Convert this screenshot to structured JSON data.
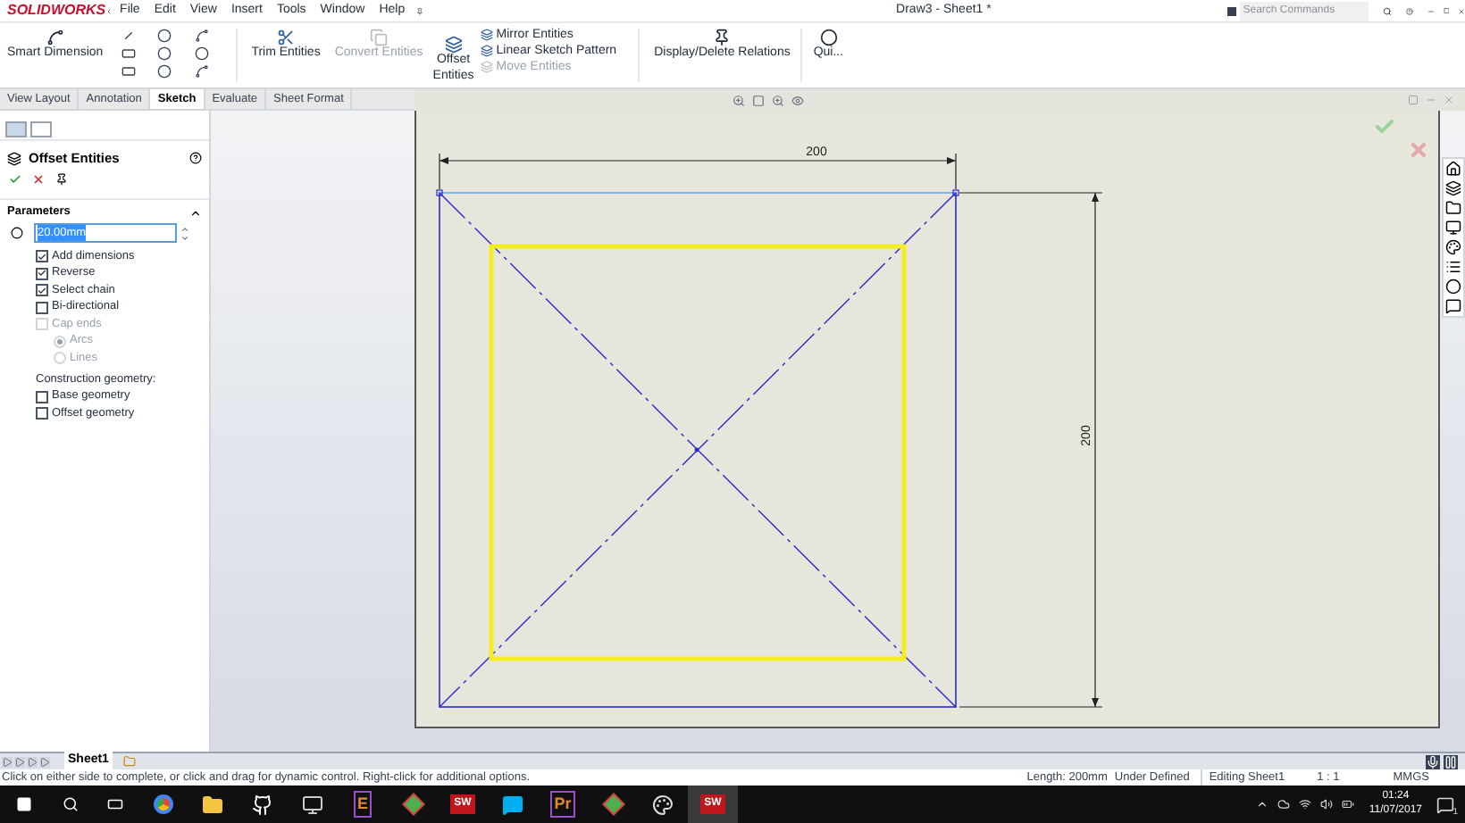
{
  "app": {
    "logo": "SOLIDWORKS",
    "menu": [
      "File",
      "Edit",
      "View",
      "Insert",
      "Tools",
      "Window",
      "Help"
    ],
    "title": "Draw3 - Sheet1 *",
    "search": {
      "placeholder": "Search Commands"
    }
  },
  "ribbon": {
    "large_tools": [
      {
        "label": "Smart Dimension",
        "disabled": false
      },
      {
        "label": "Trim Entities",
        "disabled": false
      },
      {
        "label": "Convert Entities",
        "disabled": true
      },
      {
        "label": "Offset Entities",
        "disabled": false
      }
    ],
    "small_tools": [
      {
        "label": "Mirror Entities",
        "disabled": false
      },
      {
        "label": "Linear Sketch Pattern",
        "disabled": false
      },
      {
        "label": "Move Entities",
        "disabled": true
      }
    ],
    "end_tools": [
      {
        "label": "Display/Delete Relations",
        "disabled": false
      },
      {
        "label": "Qui...",
        "disabled": false
      }
    ]
  },
  "tabs": [
    {
      "label": "View Layout",
      "selected": false
    },
    {
      "label": "Annotation",
      "selected": false
    },
    {
      "label": "Sketch",
      "selected": true
    },
    {
      "label": "Evaluate",
      "selected": false
    },
    {
      "label": "Sheet Format",
      "selected": false
    }
  ],
  "property_manager": {
    "title": "Offset Entities",
    "section": "Parameters",
    "distance": "20.00mm",
    "options": [
      {
        "kind": "checkbox",
        "label": "Add dimensions",
        "checked": true,
        "disabled": false
      },
      {
        "kind": "checkbox",
        "label": "Reverse",
        "checked": true,
        "disabled": false
      },
      {
        "kind": "checkbox",
        "label": "Select chain",
        "checked": true,
        "disabled": false
      },
      {
        "kind": "checkbox",
        "label": "Bi-directional",
        "checked": false,
        "disabled": false
      },
      {
        "kind": "checkbox",
        "label": "Cap ends",
        "checked": false,
        "disabled": true
      },
      {
        "kind": "radio",
        "label": "Arcs",
        "selected": true,
        "disabled": true
      },
      {
        "kind": "radio",
        "label": "Lines",
        "selected": false,
        "disabled": true
      },
      {
        "kind": "heading",
        "label": "Construction geometry:"
      },
      {
        "kind": "checkbox",
        "label": "Base geometry",
        "checked": false,
        "disabled": false
      },
      {
        "kind": "checkbox",
        "label": "Offset geometry",
        "checked": false,
        "disabled": false
      }
    ]
  },
  "drawing": {
    "width_dimension": "200",
    "height_dimension": "200"
  },
  "sheet_tabs": [
    {
      "label": "Sheet1",
      "selected": true
    }
  ],
  "status_bar": {
    "message": "Click on either side to complete, or click and drag for dynamic control.  Right-click for additional options.",
    "length": "Length: 200mm",
    "state": "Under Defined",
    "editing": "Editing Sheet1",
    "scale": "1 : 1",
    "units": "MMGS"
  },
  "taskbar": {
    "apps": [
      {
        "kind": "browser"
      },
      {
        "kind": "folder"
      },
      {
        "kind": "cat"
      },
      {
        "kind": "terminal"
      },
      {
        "kind": "letter",
        "glyph": "E"
      },
      {
        "kind": "diamond"
      },
      {
        "kind": "badge",
        "glyph": "SW"
      },
      {
        "kind": "chat"
      },
      {
        "kind": "letter",
        "glyph": "Pr"
      },
      {
        "kind": "diamond"
      },
      {
        "kind": "palette"
      },
      {
        "kind": "badge",
        "glyph": "SW",
        "selected": true
      }
    ],
    "time": "01:24",
    "date": "11/07/2017",
    "notifications": "1"
  }
}
